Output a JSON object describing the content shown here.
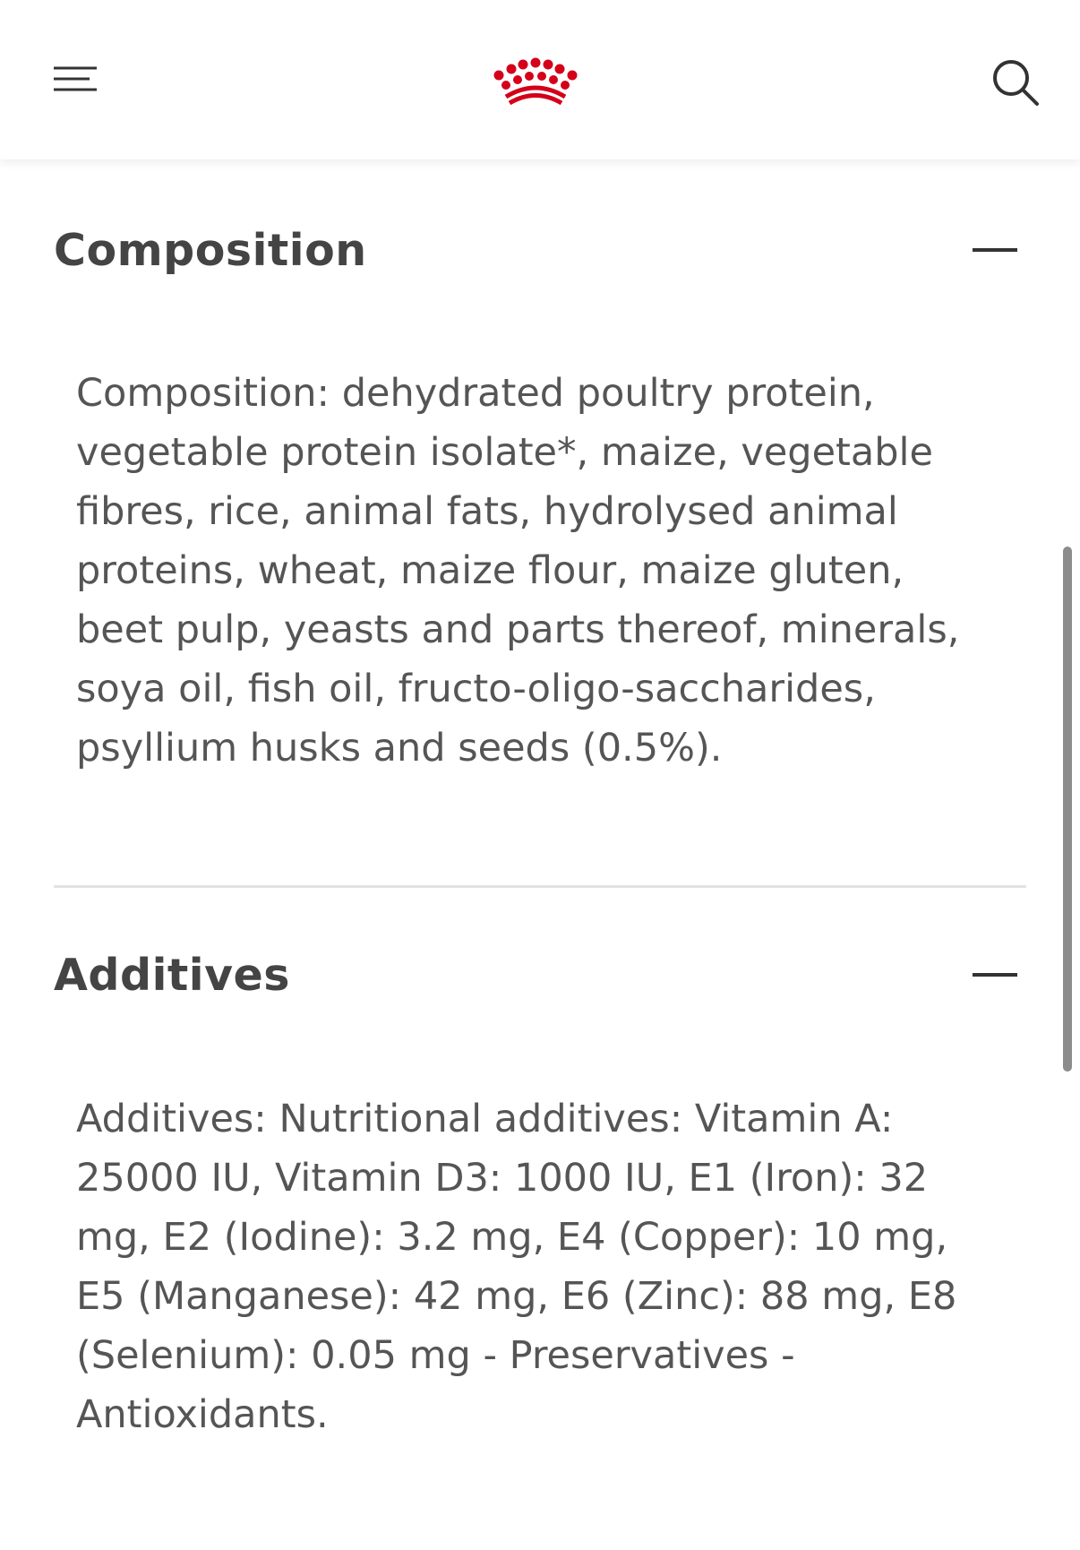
{
  "header": {
    "menu_icon": "hamburger-icon",
    "logo_icon": "crown-logo",
    "search_icon": "search-icon",
    "brand_color": "#d4001a"
  },
  "sections": [
    {
      "title": "Composition",
      "expanded": true,
      "toggle_icon": "minus-icon",
      "body": "Composition: dehydrated poultry protein, vegetable protein isolate*, maize, vegetable fibres, rice, animal fats, hydrolysed animal proteins, wheat, maize flour, maize gluten, beet pulp, yeasts and parts thereof, minerals, soya oil, fish oil, fructo-oligo-saccharides, psyllium husks and seeds (0.5%)."
    },
    {
      "title": "Additives",
      "expanded": true,
      "toggle_icon": "minus-icon",
      "body": "Additives: Nutritional additives: Vitamin A: 25000 IU, Vitamin D3: 1000 IU, E1 (Iron): 32 mg, E2 (Iodine): 3.2 mg, E4 (Copper): 10 mg, E5 (Manganese): 42 mg, E6 (Zinc): 88 mg, E8 (Selenium): 0.05 mg - Preservatives - Antioxidants."
    }
  ]
}
